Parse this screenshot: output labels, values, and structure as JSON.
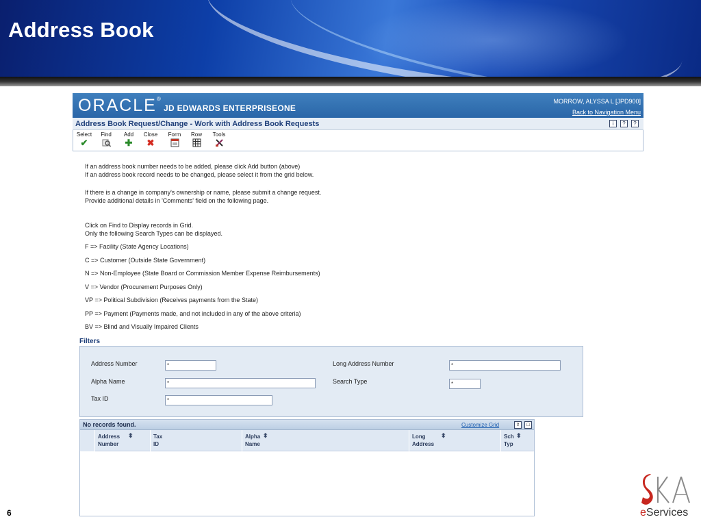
{
  "slide": {
    "title": "Address Book",
    "page_number": "6",
    "brand": {
      "initial": "e",
      "rest": "Services"
    }
  },
  "app": {
    "logo": "ORACLE",
    "logo_reg": "®",
    "product": "JD EDWARDS ENTERPRISEONE",
    "user": "MORROW, ALYSSA L  [JPD900]",
    "back_link": "Back to Navigation Menu",
    "form_title": "Address Book Request/Change - Work with Address Book Requests",
    "header_buttons": [
      "i",
      "?",
      "?"
    ]
  },
  "toolbar": {
    "buttons": [
      {
        "label": "Select",
        "icon": "check-icon",
        "glyph": "✔",
        "color": "#2a8a2a"
      },
      {
        "label": "Find",
        "icon": "find-icon",
        "glyph": "🔍",
        "color": "#555555"
      },
      {
        "label": "Add",
        "icon": "add-icon",
        "glyph": "✚",
        "color": "#2a8a2a"
      },
      {
        "label": "Close",
        "icon": "close-icon",
        "glyph": "✖",
        "color": "#d42a1f"
      },
      {
        "label": "Form",
        "icon": "form-icon",
        "glyph": "▤",
        "color": "#c0392b"
      },
      {
        "label": "Row",
        "icon": "row-icon",
        "glyph": "▦",
        "color": "#333333"
      },
      {
        "label": "Tools",
        "icon": "tools-icon",
        "glyph": "✂",
        "color": "#8a2a5a"
      }
    ]
  },
  "instructions": {
    "line1": "If an address book number needs to be added, please click Add button (above)",
    "line2": "If an address book record needs to be changed, please select it from the grid below.",
    "line3": "If there is a change in company's ownership or name, please submit a change request.",
    "line4": "Provide additional details in 'Comments' field on the following page.",
    "line5": "Click on Find to Display records in Grid.",
    "line6": "Only the following Search Types can be displayed.",
    "types": [
      "F => Facility (State Agency Locations)",
      "C => Customer (Outside State Government)",
      "N => Non-Employee (State Board or Commission Member Expense Reimbursements)",
      "V => Vendor (Procurement Purposes Only)",
      "VP => Political Subdivision (Receives payments from the State)",
      "PP => Payment (Payments made, and not included in any of the above criteria)",
      "BV => Blind and Visually Impaired Clients"
    ]
  },
  "filters": {
    "title": "Filters",
    "address_number_label": "Address Number",
    "address_number_value": "*",
    "alpha_name_label": "Alpha Name",
    "alpha_name_value": "*",
    "tax_id_label": "Tax ID",
    "tax_id_value": "*",
    "long_address_label": "Long Address Number",
    "long_address_value": "*",
    "search_type_label": "Search Type",
    "search_type_value": "*"
  },
  "grid": {
    "status": "No records found.",
    "customize": "Customize Grid",
    "columns": [
      {
        "line1": "Address",
        "line2": "Number"
      },
      {
        "line1": "Tax",
        "line2": "ID"
      },
      {
        "line1": "Alpha",
        "line2": "Name"
      },
      {
        "line1": "Long",
        "line2": "Address"
      },
      {
        "line1": "Sch",
        "line2": "Typ"
      }
    ]
  }
}
